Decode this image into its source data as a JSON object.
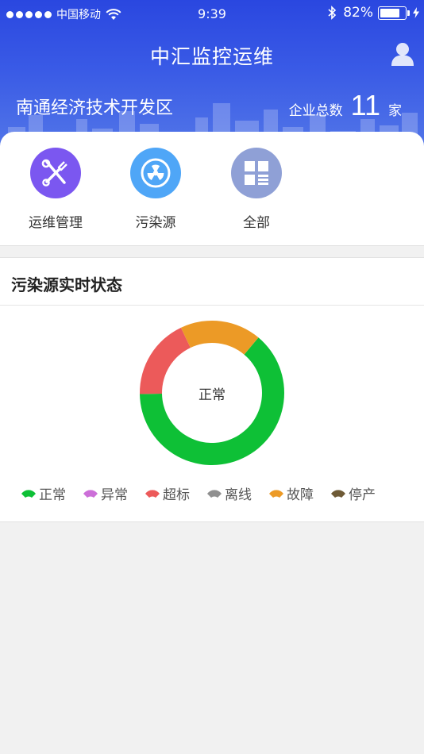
{
  "status_bar": {
    "carrier": "中国移动",
    "time": "9:39",
    "battery_percent": "82%",
    "battery_level": 0.82
  },
  "header": {
    "title": "中汇监控运维",
    "zone_name": "南通经济技术开发区",
    "count_label": "企业总数",
    "count_value": "11",
    "count_unit": "家"
  },
  "menu": [
    {
      "label": "运维管理",
      "icon": "tools-icon",
      "color": "#7b57f0"
    },
    {
      "label": "污染源",
      "icon": "radiation-icon",
      "color": "#4fa6f7"
    },
    {
      "label": "全部",
      "icon": "grid-icon",
      "color": "#8fa0d6"
    }
  ],
  "status_section": {
    "title": "污染源实时状态",
    "center_label": "正常"
  },
  "chart_data": {
    "type": "pie",
    "categories": [
      "正常",
      "异常",
      "超标",
      "离线",
      "故障",
      "停产"
    ],
    "values": [
      7,
      0,
      2,
      0,
      2,
      0
    ],
    "colors": [
      "#0ec036",
      "#cc6fd8",
      "#ec5a5a",
      "#909090",
      "#ec9a26",
      "#6e5a36"
    ],
    "legend": "bottom",
    "donut": true
  }
}
